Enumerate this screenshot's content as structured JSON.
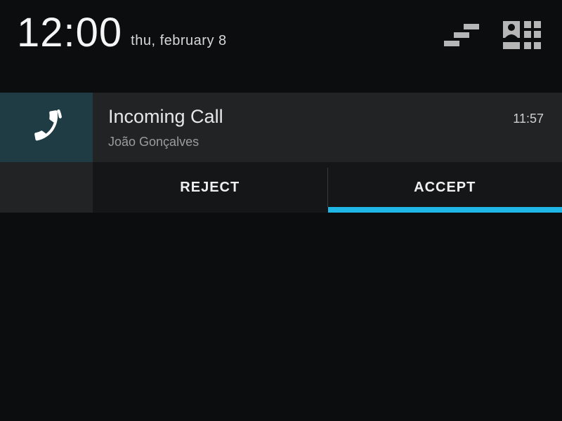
{
  "statusbar": {
    "time": "12:00",
    "date": "thu, february 8"
  },
  "notification": {
    "title": "Incoming Call",
    "time": "11:57",
    "caller": "João Gonçalves",
    "actions": {
      "reject_label": "REJECT",
      "accept_label": "ACCEPT"
    }
  },
  "colors": {
    "accent": "#1fb8e6",
    "icon_bg": "#1f3b44"
  }
}
